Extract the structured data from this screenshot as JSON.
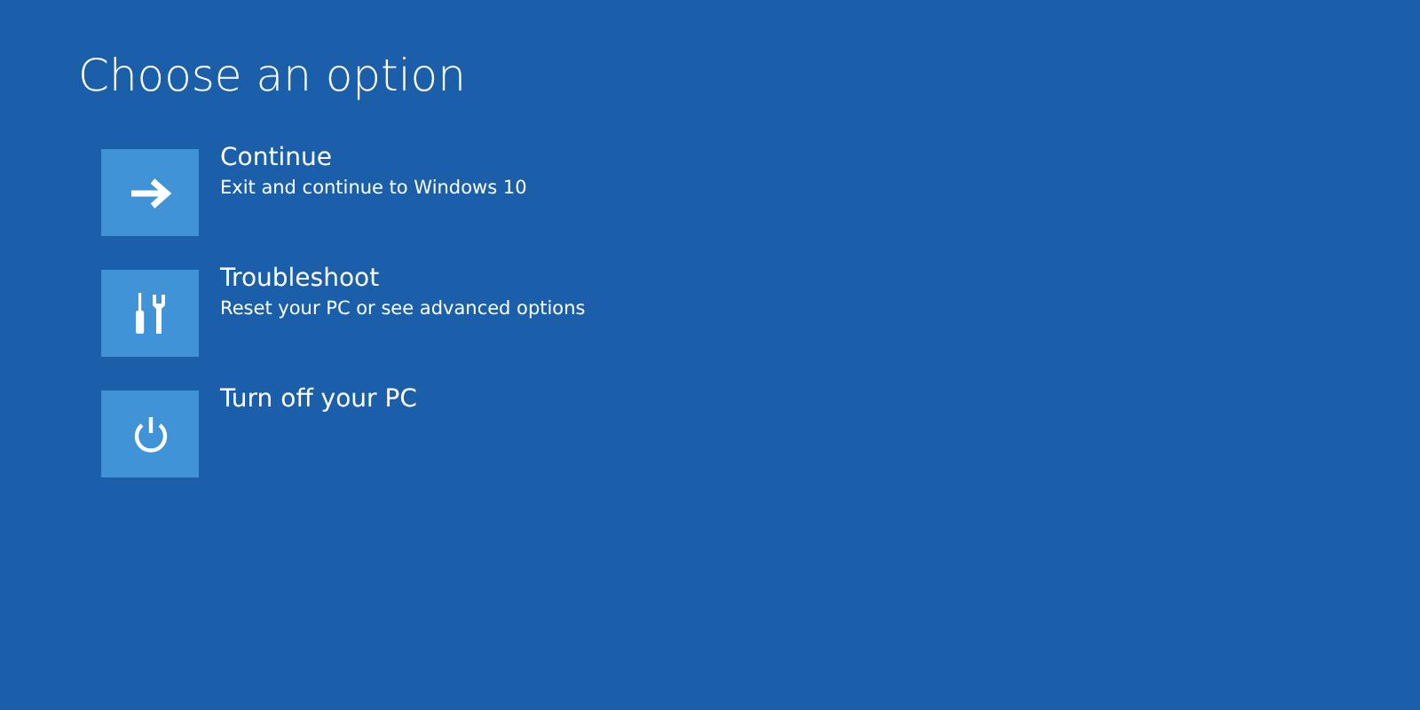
{
  "title": "Choose an option",
  "options": [
    {
      "kind": "arrow",
      "label": "Continue",
      "description": "Exit and continue to Windows 10"
    },
    {
      "kind": "tools",
      "label": "Troubleshoot",
      "description": "Reset your PC or see advanced options"
    },
    {
      "kind": "power",
      "label": "Turn off your PC"
    }
  ]
}
